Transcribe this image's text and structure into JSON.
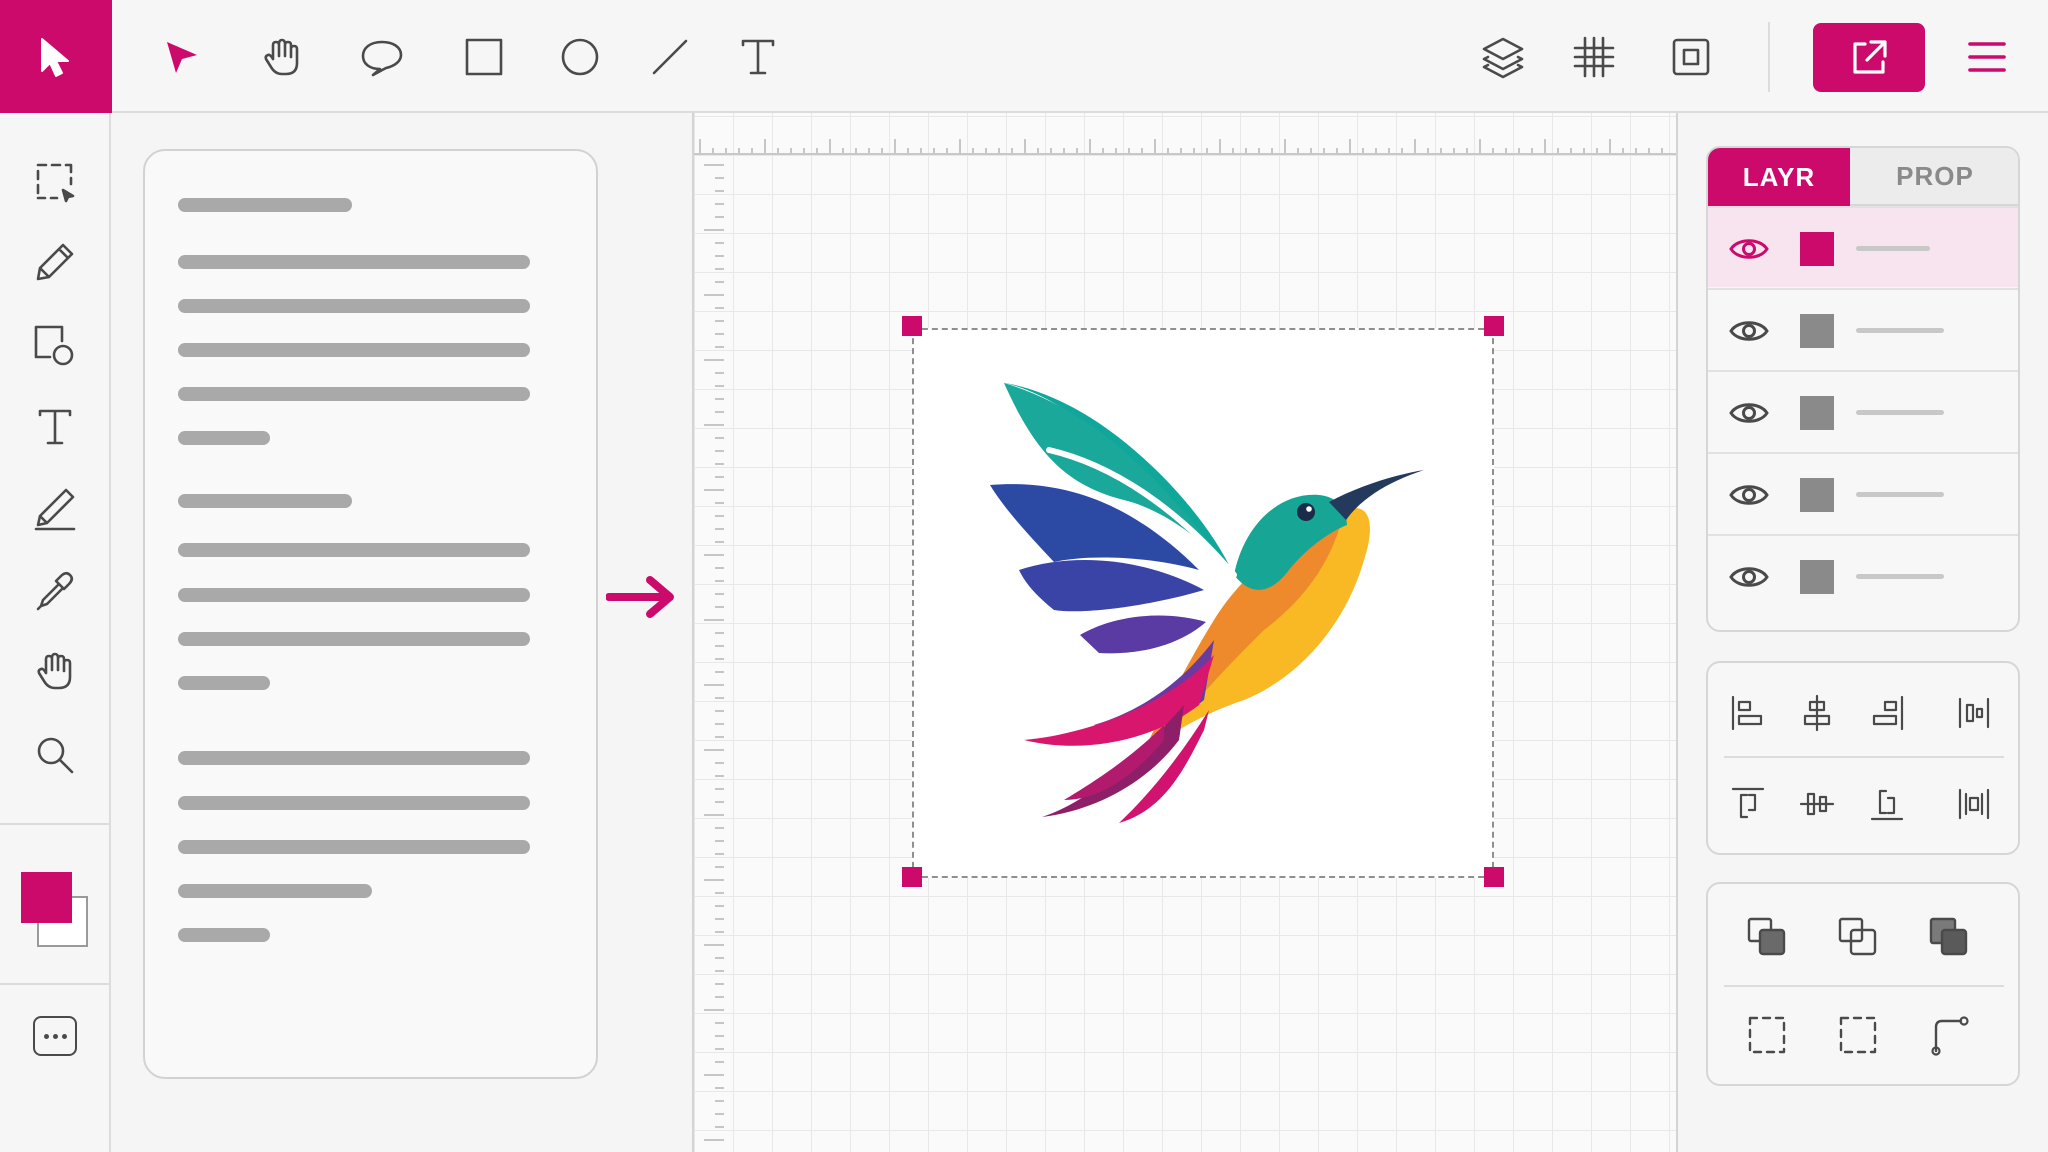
{
  "topbar": {
    "tools": [
      "pointer",
      "hand",
      "lasso",
      "rectangle",
      "ellipse",
      "line",
      "text"
    ],
    "view_buttons": [
      "layers",
      "grid",
      "frame"
    ],
    "export_icon": "external-link-icon",
    "menu_icon": "hamburger-menu-icon"
  },
  "left_toolbar": {
    "tools": [
      "marquee-select",
      "pen",
      "shapes",
      "text",
      "pencil",
      "eyedropper",
      "hand",
      "zoom"
    ],
    "fill_color": "#cc0a6b",
    "stroke_color": "#ffffff",
    "more_icon": "more-icon"
  },
  "canvas": {
    "artboard_content": "hummingbird-illustration"
  },
  "right_panel": {
    "tabs": {
      "layers_label": "LAYR",
      "properties_label": "PROP"
    },
    "layers": [
      {
        "active": true,
        "thumb_color": "#cc0a6b"
      },
      {
        "active": false,
        "thumb_color": "#8a8a8a"
      },
      {
        "active": false,
        "thumb_color": "#8a8a8a"
      },
      {
        "active": false,
        "thumb_color": "#8a8a8a"
      },
      {
        "active": false,
        "thumb_color": "#8a8a8a"
      }
    ]
  },
  "colors": {
    "accent": "#cc0a6b",
    "panel_bg": "#f6f6f6",
    "canvas_bg": "#fafafa"
  }
}
